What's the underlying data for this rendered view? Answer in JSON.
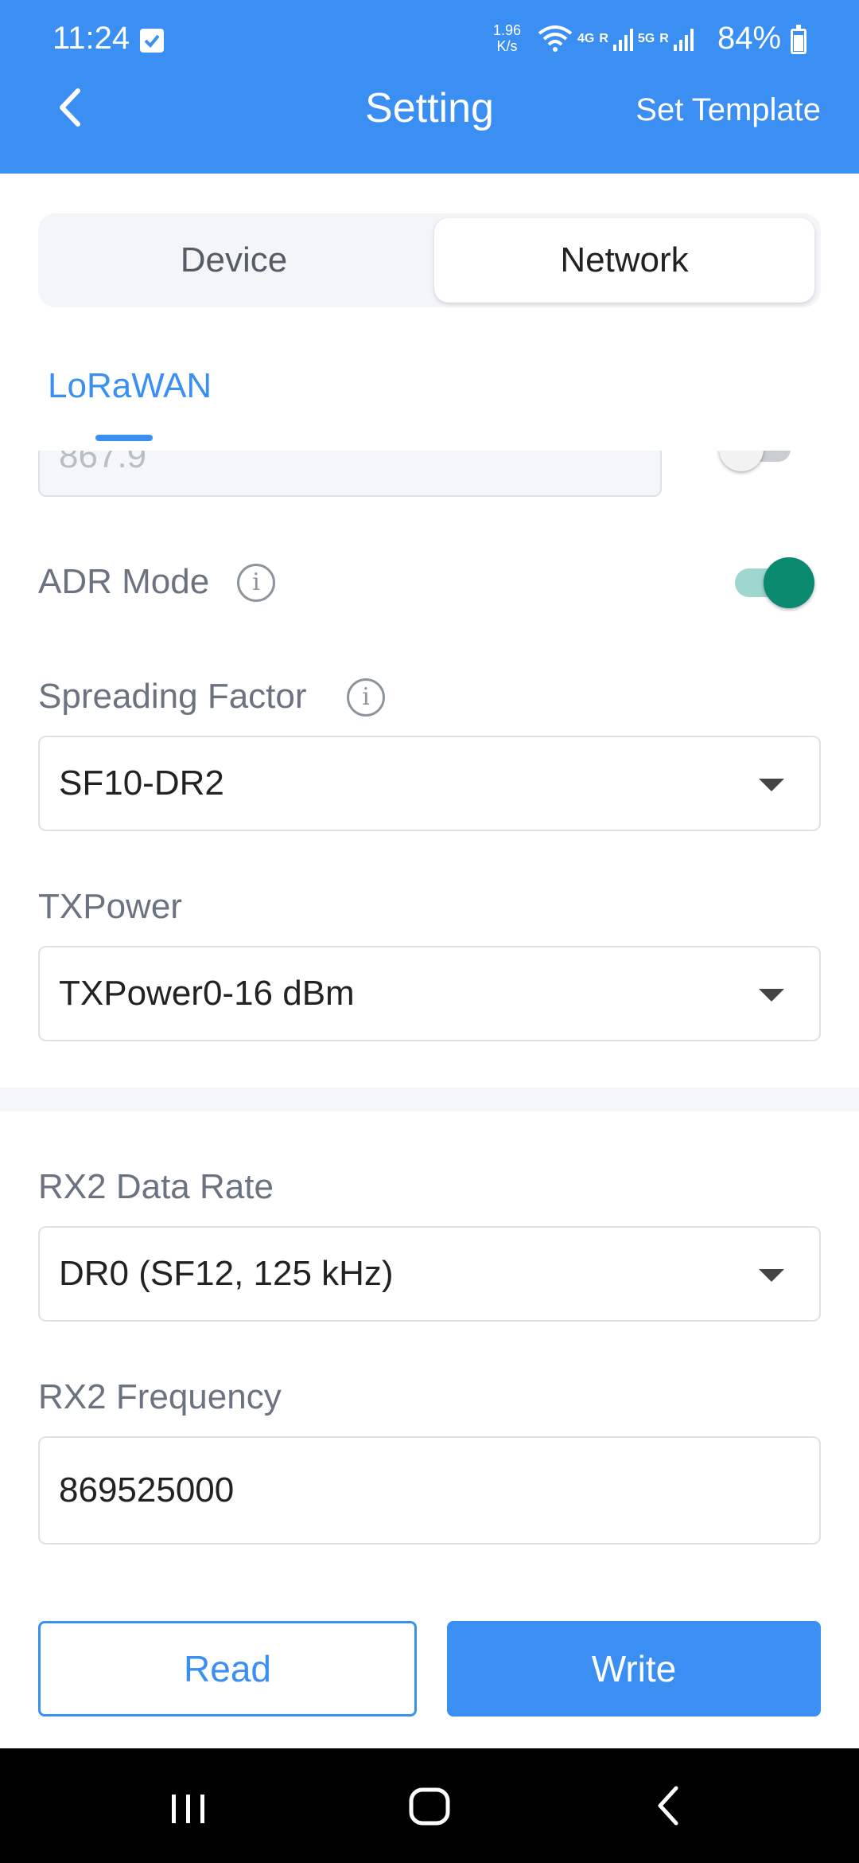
{
  "status_bar": {
    "time": "11:24",
    "speed_value": "1.96",
    "speed_unit": "K/s",
    "net1": "4G",
    "net2": "5G",
    "roaming": "R",
    "battery": "84%"
  },
  "header": {
    "title": "Setting",
    "action": "Set Template"
  },
  "tabs": {
    "device": "Device",
    "network": "Network",
    "selected": "Network"
  },
  "sub_tab": "LoRaWAN",
  "partial_field_value": "867.9",
  "form": {
    "adr_mode": {
      "label": "ADR Mode",
      "enabled": true
    },
    "spreading_factor": {
      "label": "Spreading Factor",
      "value": "SF10-DR2"
    },
    "tx_power": {
      "label": "TXPower",
      "value": "TXPower0-16 dBm"
    },
    "rx2_data_rate": {
      "label": "RX2 Data Rate",
      "value": "DR0 (SF12, 125 kHz)"
    },
    "rx2_frequency": {
      "label": "RX2 Frequency",
      "value": "869525000"
    }
  },
  "buttons": {
    "read": "Read",
    "write": "Write"
  },
  "colors": {
    "primary": "#3b8ff3",
    "toggle_on": "#0a8a6e"
  }
}
